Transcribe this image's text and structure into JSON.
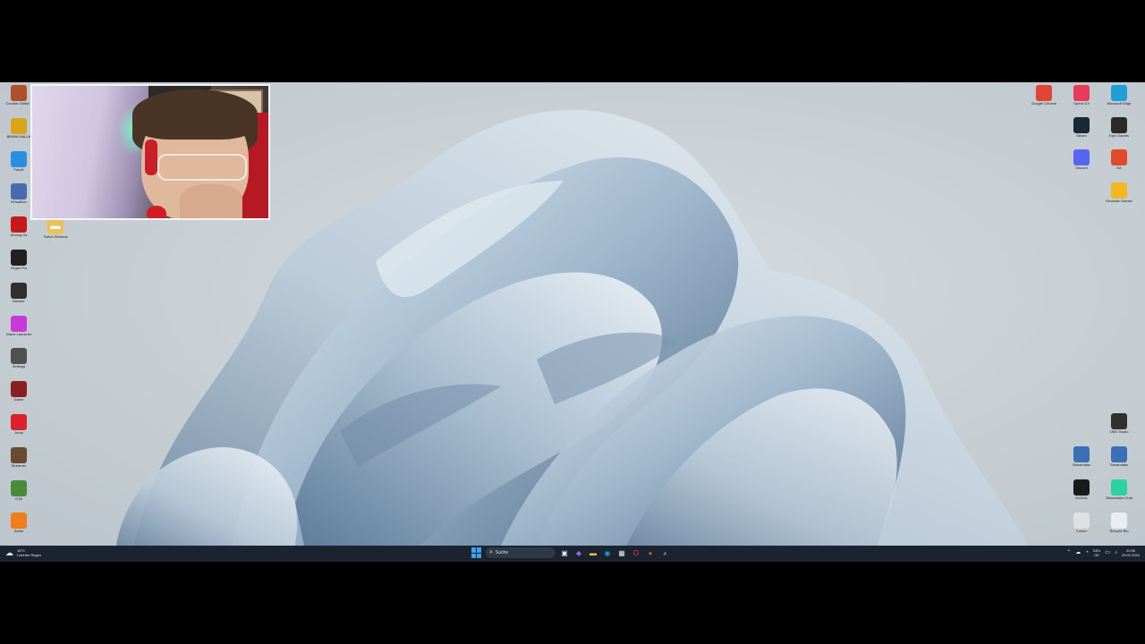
{
  "desktop": {
    "left_icons": [
      {
        "label": "Counter-Strike 2",
        "icon": "cs2-icon",
        "color": "#b0502a"
      },
      {
        "label": "BRAWLHALLA",
        "icon": "brawlhalla-icon",
        "color": "#d8a41a"
      },
      {
        "label": "Faceit",
        "icon": "faceit-icon",
        "color": "#2a8fe0"
      },
      {
        "label": "VirtualBox",
        "icon": "virtualbox-icon",
        "color": "#4a6ab0"
      },
      {
        "label": "Among Us",
        "icon": "among-us-icon",
        "color": "#c51a1a"
      },
      {
        "label": "Vegas Pro",
        "icon": "vegas-icon",
        "color": "#202020"
      },
      {
        "label": "Blender",
        "icon": "blender-icon",
        "color": "#303030"
      },
      {
        "label": "Game Launcher",
        "icon": "game-launcher-icon",
        "color": "#c73ad6"
      },
      {
        "label": "Settings",
        "icon": "gear-icon",
        "color": "#505050"
      },
      {
        "label": "Game",
        "icon": "game-icon",
        "color": "#8a1e22"
      },
      {
        "label": "Jump",
        "icon": "jump-icon",
        "color": "#d8222c"
      },
      {
        "label": "Streamer",
        "icon": "streamer-icon",
        "color": "#6a4a30"
      },
      {
        "label": "GTA",
        "icon": "gta-icon",
        "color": "#4a8a3a"
      },
      {
        "label": "Avast",
        "icon": "avast-icon",
        "color": "#f07c1a"
      }
    ],
    "folder_icon": {
      "label": "Twitch Streams",
      "icon": "folder-icon"
    },
    "right_icons_top": [
      {
        "label": "Google Chrome",
        "icon": "chrome-icon",
        "color": "#e04536"
      },
      {
        "label": "Opera GX",
        "icon": "opera-icon",
        "color": "#e83a5a"
      },
      {
        "label": "Microsoft Edge",
        "icon": "edge-icon",
        "color": "#1f9fd8"
      },
      {
        "label": "Steam",
        "icon": "steam-icon",
        "color": "#1b2838"
      },
      {
        "label": "Epic Games",
        "icon": "epic-games-icon",
        "color": "#2a2a2a"
      },
      {
        "label": "Discord",
        "icon": "discord-icon",
        "color": "#5865f2"
      },
      {
        "label": "EA",
        "icon": "ea-icon",
        "color": "#e24a2a"
      },
      {
        "label": "Rockstar Games",
        "icon": "rockstar-icon",
        "color": "#f2b81e"
      }
    ],
    "right_icons_bottom": [
      {
        "label": "OBS Studio",
        "icon": "obs-icon",
        "color": "#303030"
      },
      {
        "label": "Streamlabs",
        "icon": "streamlabs-icon",
        "color": "#3d6fb6"
      },
      {
        "label": "Streamlabs",
        "icon": "streamlabs-icon",
        "color": "#3d6fb6"
      },
      {
        "label": "NVIDIA",
        "icon": "nvidia-icon",
        "color": "#1a1a1a"
      },
      {
        "label": "Streamlabs Chat",
        "icon": "chat-icon",
        "color": "#2ad3a0"
      },
      {
        "label": "Cursor",
        "icon": "cursor-icon",
        "color": "#e0e0e0"
      },
      {
        "label": "Recycle Bin",
        "icon": "recycle-bin-icon",
        "color": "#e8eef3"
      }
    ]
  },
  "taskbar": {
    "weather_temp": "16°C",
    "weather_desc": "Leichter Regen",
    "search_placeholder": "Suche",
    "apps": [
      {
        "icon": "task-view-icon",
        "glyph": "▣",
        "color": "#dfe5eb"
      },
      {
        "icon": "copilot-icon",
        "glyph": "◆",
        "color": "#8a6ae0"
      },
      {
        "icon": "file-explorer-icon",
        "glyph": "▬",
        "color": "#f2c440"
      },
      {
        "icon": "edge-icon",
        "glyph": "◉",
        "color": "#1f9fd8"
      },
      {
        "icon": "store-icon",
        "glyph": "▦",
        "color": "#dfe5eb"
      },
      {
        "icon": "opera-icon",
        "glyph": "O",
        "color": "#e83a5a"
      },
      {
        "icon": "chrome-icon",
        "glyph": "●",
        "color": "#e04536"
      },
      {
        "icon": "discord-icon",
        "glyph": "◕",
        "color": "#8a6ae0"
      }
    ],
    "lang_1": "DEU",
    "lang_2": "DE",
    "time": "22:56",
    "date": "29.02.2024"
  }
}
